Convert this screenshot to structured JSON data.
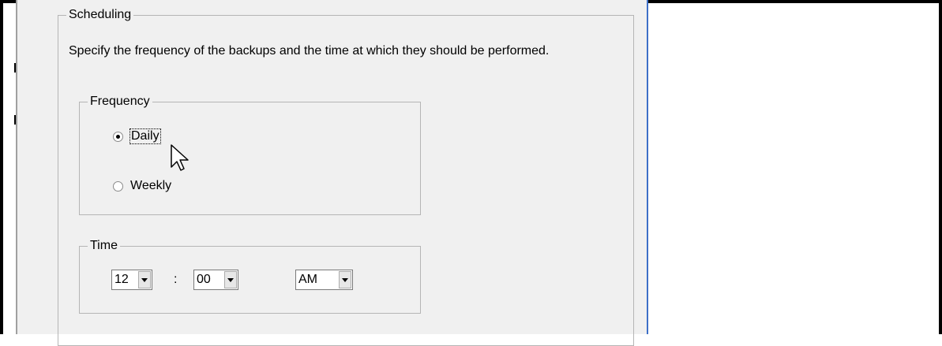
{
  "scheduling": {
    "legend": "Scheduling",
    "description": "Specify the frequency of the backups and the time at which they should be performed."
  },
  "frequency": {
    "legend": "Frequency",
    "options": [
      {
        "label": "Daily",
        "selected": true
      },
      {
        "label": "Weekly",
        "selected": false
      }
    ]
  },
  "time": {
    "legend": "Time",
    "hour": "12",
    "separator": ":",
    "minute": "00",
    "period": "AM"
  },
  "icons": {
    "dropdown": "chevron-down-icon",
    "cursor": "mouse-pointer-icon"
  },
  "colors": {
    "panel_bg": "#f0f0f0",
    "group_border": "#b5b5b5",
    "panel_edge": "#3d6fc8"
  }
}
